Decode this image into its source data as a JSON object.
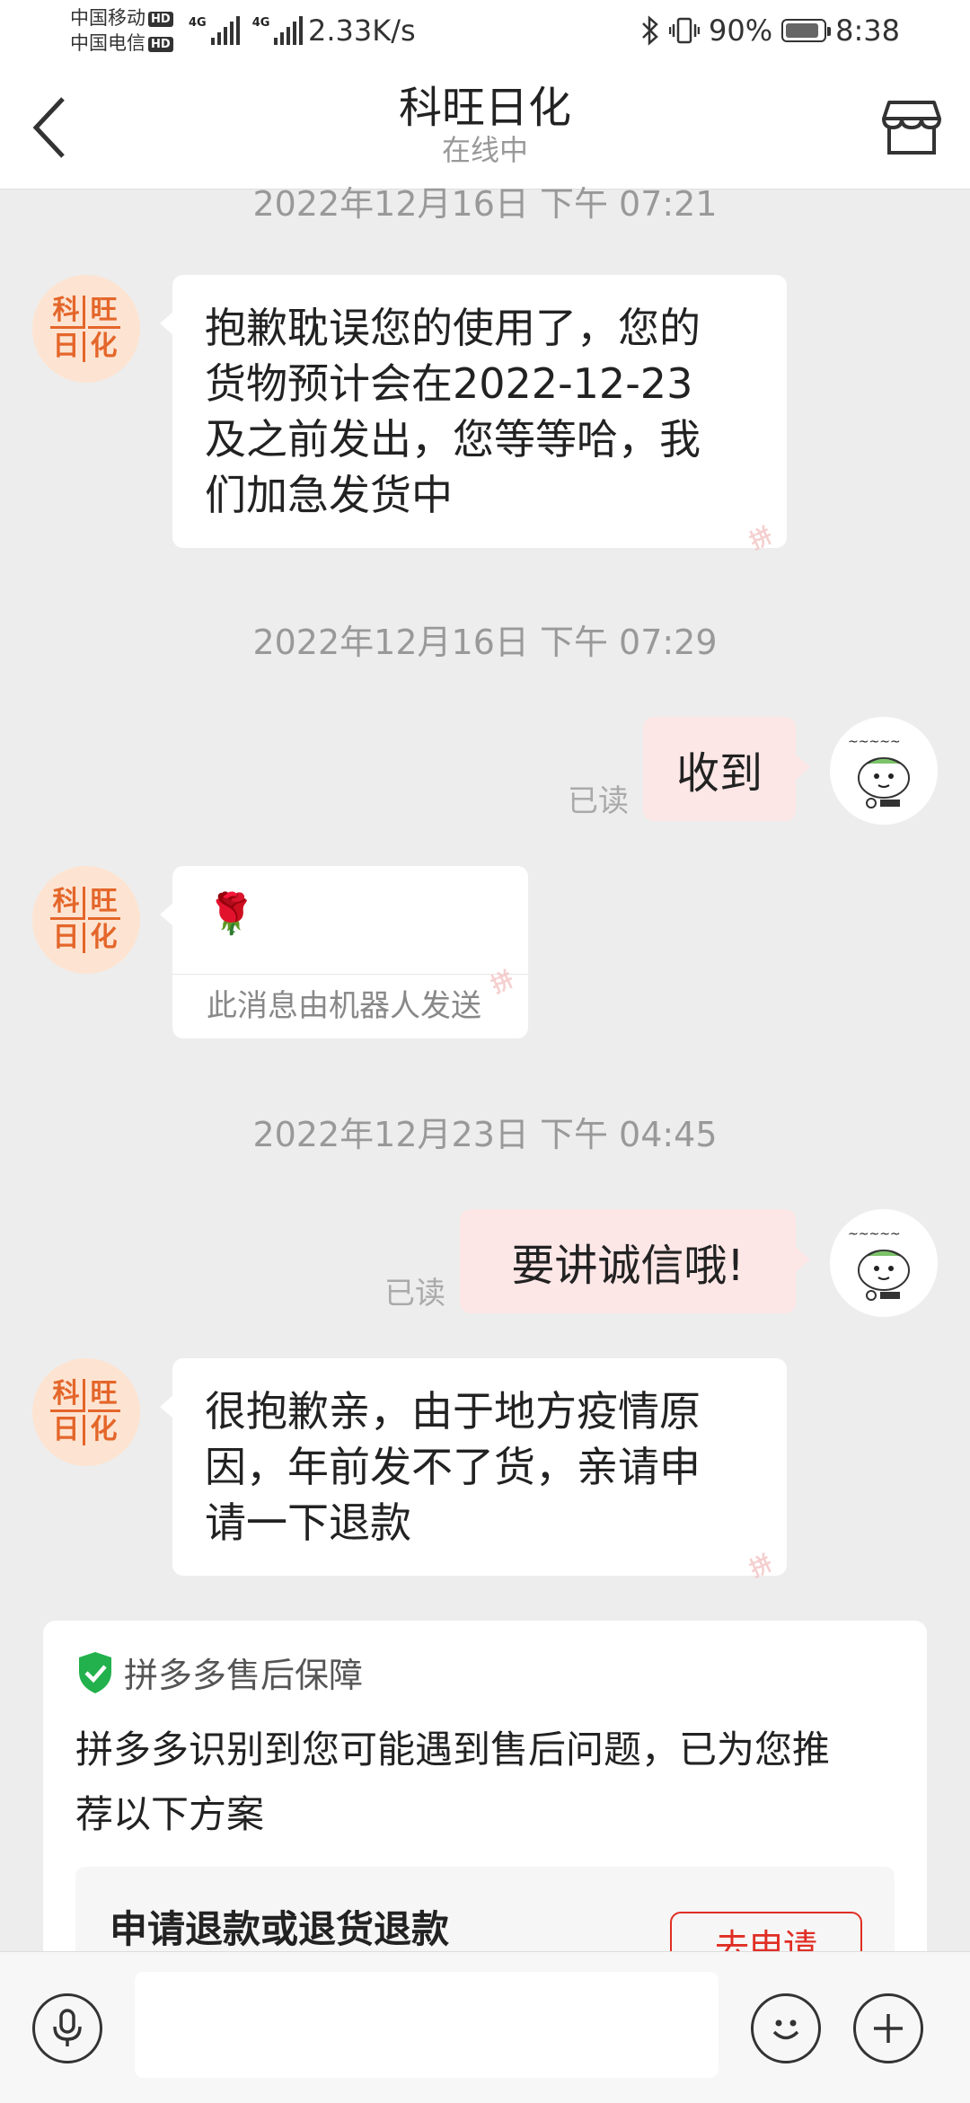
{
  "status_bar": {
    "carrier1": "中国移动",
    "carrier2": "中国电信",
    "hd": "HD",
    "net": "4G",
    "speed": "2.33K/s",
    "battery": "90%",
    "time": "8:38"
  },
  "header": {
    "title": "科旺日化",
    "subtitle": "在线中"
  },
  "shop_logo": [
    "科",
    "旺",
    "日",
    "化"
  ],
  "watermark": "拼",
  "messages": {
    "ts0": "2022年12月16日 下午 07:21",
    "m1": [
      "抱歉耽误您的使用了，您的",
      "货物预计会在2022-12-23",
      "及之前发出，您等等哈，我",
      "们加急发货中"
    ],
    "ts1": "2022年12月16日 下午 07:29",
    "m2": "收到",
    "read_label": "已读",
    "m3_emoji": "🌹",
    "m3_note": "此消息由机器人发送",
    "ts2": "2022年12月23日 下午 04:45",
    "m4": "要讲诚信哦!",
    "m5": [
      "很抱歉亲，由于地方疫情原",
      "因，年前发不了货，亲请申",
      "请一下退款"
    ]
  },
  "protection_card": {
    "title": "拼多多售后保障",
    "text": [
      "拼多多识别到您可能遇到售后问题，已为您推",
      "荐以下方案"
    ],
    "option_title": "申请退款或退货退款",
    "option_button": "去申请"
  },
  "input_bar": {
    "placeholder": ""
  },
  "colors": {
    "accent_red": "#e02e24",
    "shop_orange": "#e4662a",
    "bubble_me": "#fde6e6",
    "shield_green": "#22b14c"
  }
}
